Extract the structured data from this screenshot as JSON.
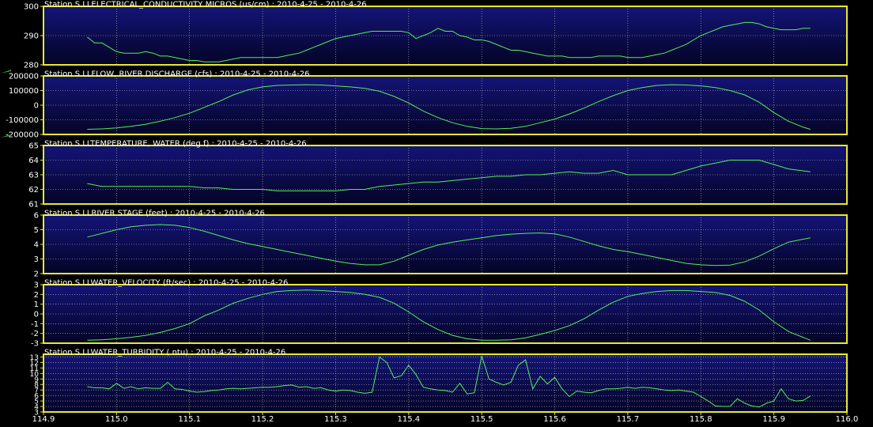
{
  "colors": {
    "background": "#000000",
    "plot_bg_top": "#141478",
    "plot_bg_bottom": "#040426",
    "frame": "#e8e830",
    "grid": "#c8c8c8",
    "line": "#55ee55",
    "text": "#ffffff",
    "marker": "#2fa04a"
  },
  "chart_data": [
    {
      "type": "line",
      "title": "Station S.LLELECTRICAL_CONDUCTIVITY MICROS (us/cm) : 2010-4-25 - 2010-4-26",
      "ylim": [
        280,
        300
      ],
      "yticks": [
        "300",
        "290",
        "280"
      ],
      "ytick_values": [
        300,
        290,
        280
      ],
      "grid": true,
      "x": [
        114.96,
        114.97,
        114.98,
        114.99,
        115.0,
        115.01,
        115.02,
        115.03,
        115.04,
        115.05,
        115.06,
        115.07,
        115.08,
        115.09,
        115.1,
        115.11,
        115.12,
        115.13,
        115.14,
        115.15,
        115.16,
        115.17,
        115.18,
        115.19,
        115.2,
        115.21,
        115.22,
        115.23,
        115.24,
        115.25,
        115.26,
        115.27,
        115.28,
        115.29,
        115.3,
        115.31,
        115.32,
        115.33,
        115.34,
        115.35,
        115.36,
        115.37,
        115.38,
        115.39,
        115.4,
        115.41,
        115.42,
        115.43,
        115.44,
        115.45,
        115.46,
        115.47,
        115.48,
        115.49,
        115.5,
        115.51,
        115.52,
        115.53,
        115.54,
        115.55,
        115.56,
        115.57,
        115.58,
        115.59,
        115.6,
        115.61,
        115.62,
        115.63,
        115.64,
        115.65,
        115.66,
        115.67,
        115.68,
        115.69,
        115.7,
        115.71,
        115.72,
        115.73,
        115.74,
        115.75,
        115.76,
        115.77,
        115.78,
        115.79,
        115.8,
        115.81,
        115.82,
        115.83,
        115.84,
        115.85,
        115.86,
        115.87,
        115.88,
        115.89,
        115.9,
        115.91,
        115.92,
        115.93,
        115.94,
        115.95
      ],
      "values": [
        289.5,
        287.5,
        287.5,
        286,
        284.5,
        284,
        284,
        284,
        284.5,
        284,
        283,
        283,
        282.5,
        282,
        281.5,
        281.5,
        281,
        281,
        281,
        281.5,
        282,
        282.5,
        282.5,
        282.5,
        282.5,
        282.5,
        282.5,
        283,
        283.5,
        284,
        285,
        286,
        287,
        288,
        289,
        289.5,
        290,
        290.5,
        291,
        291.5,
        291.5,
        291.5,
        291.5,
        291.5,
        291,
        289,
        290,
        291,
        292.5,
        291.5,
        291.5,
        290,
        289.5,
        288.5,
        288.5,
        288,
        287,
        286,
        285,
        285,
        284.5,
        284,
        283.5,
        283,
        283,
        283,
        282.5,
        282.5,
        282.5,
        282.5,
        283,
        283,
        283,
        283,
        282.5,
        282.5,
        282.5,
        283,
        283.5,
        284,
        285,
        286,
        287,
        288.5,
        290,
        291,
        292,
        293,
        293.5,
        294,
        294.5,
        294.5,
        294,
        293,
        292.5,
        292,
        292,
        292,
        292.5,
        292.5
      ]
    },
    {
      "type": "line",
      "title": "Station S.LLFLOW, RIVER DISCHARGE (cfs) : 2010-4-25 - 2010-4-26",
      "ylim": [
        -200000,
        200000
      ],
      "yticks": [
        "200000",
        "100000",
        "0",
        "-100000",
        "-200000"
      ],
      "ytick_values": [
        200000,
        100000,
        0,
        -100000,
        -200000
      ],
      "grid": true,
      "x": [
        114.96,
        114.98,
        115.0,
        115.02,
        115.04,
        115.06,
        115.08,
        115.1,
        115.12,
        115.14,
        115.16,
        115.18,
        115.2,
        115.22,
        115.24,
        115.26,
        115.28,
        115.3,
        115.32,
        115.34,
        115.36,
        115.38,
        115.4,
        115.42,
        115.44,
        115.46,
        115.48,
        115.5,
        115.52,
        115.54,
        115.56,
        115.58,
        115.6,
        115.62,
        115.64,
        115.66,
        115.68,
        115.7,
        115.72,
        115.74,
        115.76,
        115.78,
        115.8,
        115.82,
        115.84,
        115.86,
        115.88,
        115.9,
        115.92,
        115.94,
        115.95
      ],
      "values": [
        -165000,
        -162000,
        -155000,
        -145000,
        -130000,
        -110000,
        -85000,
        -55000,
        -15000,
        25000,
        70000,
        105000,
        125000,
        135000,
        138000,
        140000,
        138000,
        132000,
        125000,
        115000,
        95000,
        60000,
        15000,
        -40000,
        -85000,
        -120000,
        -145000,
        -160000,
        -162000,
        -158000,
        -145000,
        -120000,
        -95000,
        -60000,
        -20000,
        25000,
        65000,
        100000,
        120000,
        135000,
        140000,
        138000,
        132000,
        120000,
        100000,
        70000,
        20000,
        -50000,
        -110000,
        -150000,
        -165000
      ]
    },
    {
      "type": "line",
      "title": "Station S.LLTEMPERATURE, WATER (deg f) : 2010-4-25 - 2010-4-26",
      "ylim": [
        61,
        65
      ],
      "yticks": [
        "65",
        "64",
        "63",
        "62",
        "61"
      ],
      "ytick_values": [
        65,
        64,
        63,
        62,
        61
      ],
      "grid": true,
      "x": [
        114.96,
        114.98,
        115.0,
        115.02,
        115.04,
        115.06,
        115.08,
        115.1,
        115.12,
        115.14,
        115.16,
        115.18,
        115.2,
        115.22,
        115.24,
        115.26,
        115.28,
        115.3,
        115.32,
        115.34,
        115.36,
        115.38,
        115.4,
        115.42,
        115.44,
        115.46,
        115.48,
        115.5,
        115.52,
        115.54,
        115.56,
        115.58,
        115.6,
        115.62,
        115.64,
        115.66,
        115.68,
        115.7,
        115.72,
        115.74,
        115.76,
        115.78,
        115.8,
        115.82,
        115.84,
        115.86,
        115.88,
        115.9,
        115.92,
        115.95
      ],
      "values": [
        62.4,
        62.2,
        62.2,
        62.2,
        62.2,
        62.2,
        62.2,
        62.2,
        62.1,
        62.1,
        62.0,
        62.0,
        62.0,
        61.9,
        61.9,
        61.9,
        61.9,
        61.9,
        62.0,
        62.0,
        62.2,
        62.3,
        62.4,
        62.5,
        62.5,
        62.6,
        62.7,
        62.8,
        62.9,
        62.9,
        63.0,
        63.0,
        63.1,
        63.2,
        63.1,
        63.1,
        63.3,
        63.0,
        63.0,
        63.0,
        63.0,
        63.3,
        63.6,
        63.8,
        64.0,
        64.0,
        64.0,
        63.7,
        63.4,
        63.2
      ]
    },
    {
      "type": "line",
      "title": "Station S.LLRIVER STAGE (feet) : 2010-4-25 - 2010-4-26",
      "ylim": [
        2,
        6
      ],
      "yticks": [
        "6",
        "5",
        "4",
        "3",
        "2"
      ],
      "ytick_values": [
        6,
        5,
        4,
        3,
        2
      ],
      "grid": true,
      "x": [
        114.96,
        114.98,
        115.0,
        115.02,
        115.04,
        115.06,
        115.08,
        115.1,
        115.12,
        115.14,
        115.16,
        115.18,
        115.2,
        115.22,
        115.24,
        115.26,
        115.28,
        115.3,
        115.32,
        115.34,
        115.36,
        115.38,
        115.4,
        115.42,
        115.44,
        115.46,
        115.48,
        115.5,
        115.52,
        115.54,
        115.56,
        115.58,
        115.6,
        115.62,
        115.64,
        115.66,
        115.68,
        115.7,
        115.72,
        115.74,
        115.76,
        115.78,
        115.8,
        115.82,
        115.84,
        115.86,
        115.88,
        115.9,
        115.92,
        115.95
      ],
      "values": [
        4.5,
        4.75,
        5.0,
        5.2,
        5.3,
        5.35,
        5.3,
        5.15,
        4.9,
        4.6,
        4.3,
        4.05,
        3.85,
        3.65,
        3.45,
        3.25,
        3.05,
        2.85,
        2.7,
        2.6,
        2.6,
        2.85,
        3.25,
        3.65,
        3.95,
        4.15,
        4.3,
        4.45,
        4.6,
        4.7,
        4.75,
        4.78,
        4.72,
        4.5,
        4.2,
        3.9,
        3.65,
        3.5,
        3.3,
        3.1,
        2.9,
        2.7,
        2.6,
        2.55,
        2.58,
        2.8,
        3.2,
        3.7,
        4.15,
        4.45
      ]
    },
    {
      "type": "line",
      "title": "Station S.LLWATER_VELOCITY (ft/sec) : 2010-4-25 - 2010-4-26",
      "ylim": [
        -3,
        3
      ],
      "yticks": [
        "3",
        "2",
        "1",
        "0",
        "-1",
        "-2",
        "-3"
      ],
      "ytick_values": [
        3,
        2,
        1,
        0,
        -1,
        -2,
        -3
      ],
      "grid": true,
      "x": [
        114.96,
        114.98,
        115.0,
        115.02,
        115.04,
        115.06,
        115.08,
        115.1,
        115.12,
        115.14,
        115.16,
        115.18,
        115.2,
        115.22,
        115.24,
        115.26,
        115.28,
        115.3,
        115.32,
        115.34,
        115.36,
        115.38,
        115.4,
        115.42,
        115.44,
        115.46,
        115.48,
        115.5,
        115.52,
        115.54,
        115.56,
        115.58,
        115.6,
        115.62,
        115.64,
        115.66,
        115.68,
        115.7,
        115.72,
        115.74,
        115.76,
        115.78,
        115.8,
        115.82,
        115.84,
        115.86,
        115.88,
        115.9,
        115.92,
        115.94,
        115.95
      ],
      "values": [
        -2.7,
        -2.65,
        -2.55,
        -2.4,
        -2.2,
        -1.9,
        -1.5,
        -1.0,
        -0.2,
        0.4,
        1.1,
        1.6,
        2.0,
        2.3,
        2.4,
        2.45,
        2.4,
        2.3,
        2.2,
        2.0,
        1.7,
        1.1,
        0.2,
        -0.8,
        -1.6,
        -2.2,
        -2.55,
        -2.7,
        -2.7,
        -2.65,
        -2.45,
        -2.1,
        -1.7,
        -1.2,
        -0.5,
        0.4,
        1.2,
        1.8,
        2.1,
        2.3,
        2.4,
        2.4,
        2.3,
        2.2,
        1.9,
        1.3,
        0.4,
        -0.8,
        -1.8,
        -2.4,
        -2.7
      ]
    },
    {
      "type": "line",
      "title": "Station S.LLWATER_TURBIDITY (  ntu) : 2010-4-25 - 2010-4-26",
      "ylim": [
        3,
        13.5
      ],
      "yticks": [
        "13",
        "12",
        "11",
        "10",
        "9",
        "8",
        "7",
        "6",
        "5",
        "4",
        "3"
      ],
      "ytick_values": [
        13,
        12,
        11,
        10,
        9,
        8,
        7,
        6,
        5,
        4,
        3
      ],
      "grid": true,
      "x": [
        114.96,
        114.97,
        114.98,
        114.99,
        115.0,
        115.01,
        115.02,
        115.03,
        115.04,
        115.05,
        115.06,
        115.07,
        115.08,
        115.09,
        115.1,
        115.11,
        115.12,
        115.13,
        115.14,
        115.15,
        115.16,
        115.17,
        115.18,
        115.19,
        115.2,
        115.21,
        115.22,
        115.23,
        115.24,
        115.25,
        115.26,
        115.27,
        115.28,
        115.29,
        115.3,
        115.31,
        115.32,
        115.33,
        115.34,
        115.35,
        115.36,
        115.37,
        115.38,
        115.39,
        115.4,
        115.41,
        115.42,
        115.43,
        115.44,
        115.45,
        115.46,
        115.47,
        115.48,
        115.49,
        115.5,
        115.51,
        115.52,
        115.53,
        115.54,
        115.55,
        115.56,
        115.57,
        115.58,
        115.59,
        115.6,
        115.61,
        115.62,
        115.63,
        115.64,
        115.65,
        115.66,
        115.67,
        115.68,
        115.69,
        115.7,
        115.71,
        115.72,
        115.73,
        115.74,
        115.75,
        115.76,
        115.77,
        115.78,
        115.79,
        115.8,
        115.81,
        115.82,
        115.83,
        115.84,
        115.85,
        115.86,
        115.87,
        115.88,
        115.89,
        115.9,
        115.91,
        115.92,
        115.93,
        115.94,
        115.95
      ],
      "values": [
        7.6,
        7.4,
        7.4,
        7.2,
        8.2,
        7.3,
        7.6,
        7.2,
        7.4,
        7.3,
        7.3,
        8.4,
        7.2,
        7.1,
        6.8,
        6.6,
        6.7,
        6.9,
        7.0,
        7.2,
        7.3,
        7.2,
        7.3,
        7.4,
        7.5,
        7.5,
        7.6,
        7.8,
        7.9,
        7.5,
        7.6,
        7.3,
        7.4,
        7.0,
        6.8,
        7.0,
        6.9,
        6.6,
        6.4,
        6.6,
        13.0,
        12.0,
        9.2,
        9.6,
        11.5,
        9.8,
        7.5,
        7.2,
        7.0,
        6.9,
        6.6,
        8.2,
        6.3,
        6.5,
        13.2,
        9.0,
        8.4,
        7.9,
        8.4,
        11.5,
        12.5,
        7.2,
        9.5,
        8.1,
        9.3,
        7.2,
        5.8,
        6.8,
        6.6,
        6.5,
        6.9,
        7.2,
        7.2,
        7.3,
        7.5,
        7.3,
        7.5,
        7.4,
        7.2,
        7.0,
        6.9,
        7.0,
        6.8,
        6.6,
        5.8,
        5.0,
        4.1,
        4.0,
        4.0,
        5.4,
        4.6,
        4.1,
        3.9,
        4.6,
        5.0,
        7.2,
        5.4,
        5.0,
        5.1,
        5.9
      ]
    }
  ],
  "xaxis": {
    "range": [
      114.9,
      116.0
    ],
    "ticks": [
      "114.9",
      "115.0",
      "115.1",
      "115.2",
      "115.3",
      "115.4",
      "115.5",
      "115.6",
      "115.7",
      "115.8",
      "115.9",
      "116.0"
    ],
    "tick_values": [
      114.9,
      115.0,
      115.1,
      115.2,
      115.3,
      115.4,
      115.5,
      115.6,
      115.7,
      115.8,
      115.9,
      116.0
    ]
  }
}
